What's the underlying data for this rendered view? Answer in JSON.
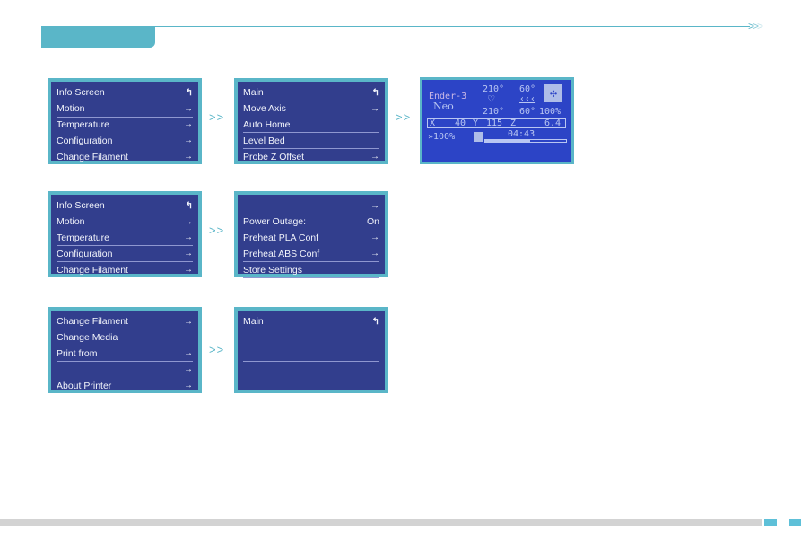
{
  "header": {
    "chevrons": [
      ">",
      ">",
      ">"
    ]
  },
  "icons": {
    "back": "↰",
    "next": "→"
  },
  "separator": ">>",
  "row1": {
    "main_menu": [
      {
        "label": "Info Screen",
        "icon": "↰"
      },
      {
        "label": "Motion",
        "icon": "→"
      },
      {
        "label": "Temperature",
        "icon": "→"
      },
      {
        "label": "Configuration",
        "icon": "→"
      },
      {
        "label": "Change Filament",
        "icon": "→"
      }
    ],
    "motion_menu": [
      {
        "label": "Main",
        "icon": "↰"
      },
      {
        "label": "Move Axis",
        "icon": "→"
      },
      {
        "label": "Auto Home",
        "icon": ""
      },
      {
        "label": "Level Bed",
        "icon": ""
      },
      {
        "label": "Probe Z Offset",
        "icon": "→"
      }
    ],
    "info_screen": {
      "model_line1": "Ender-3",
      "model_line2": "Neo",
      "hotend_target": "210°",
      "hotend_current": "210°",
      "bed_target": "60°",
      "bed_current": "60°",
      "fan_speed": "100%",
      "x_label": "X",
      "x_value": "40",
      "y_label": "Y",
      "y_value": "115",
      "z_label": "Z",
      "z_value": "6.4",
      "feedrate": "»100%",
      "print_time": "04:43",
      "progress_fraction": 0.55
    }
  },
  "row2": {
    "main_menu": [
      {
        "label": "Info Screen",
        "icon": "↰"
      },
      {
        "label": "Motion",
        "icon": "→"
      },
      {
        "label": "Temperature",
        "icon": "→"
      },
      {
        "label": "Configuration",
        "icon": "→"
      },
      {
        "label": "Change Filament",
        "icon": "→"
      }
    ],
    "config_menu": [
      {
        "label": "",
        "icon": "→"
      },
      {
        "label": "Power Outage:",
        "icon": "On"
      },
      {
        "label": "Preheat PLA Conf",
        "icon": "→"
      },
      {
        "label": "Preheat ABS Conf",
        "icon": "→"
      },
      {
        "label": "Store Settings",
        "icon": ""
      }
    ]
  },
  "row3": {
    "main_menu": [
      {
        "label": "Change Filament",
        "icon": "→"
      },
      {
        "label": "Change Media",
        "icon": ""
      },
      {
        "label": "Print from",
        "icon": "→"
      },
      {
        "label": "",
        "icon": "→"
      },
      {
        "label": "About Printer",
        "icon": "→"
      }
    ],
    "sub_menu": [
      {
        "label": "Main",
        "icon": "↰"
      },
      {
        "label": "",
        "icon": ""
      },
      {
        "label": "",
        "icon": ""
      },
      {
        "label": "",
        "icon": ""
      },
      {
        "label": "",
        "icon": ""
      }
    ]
  }
}
